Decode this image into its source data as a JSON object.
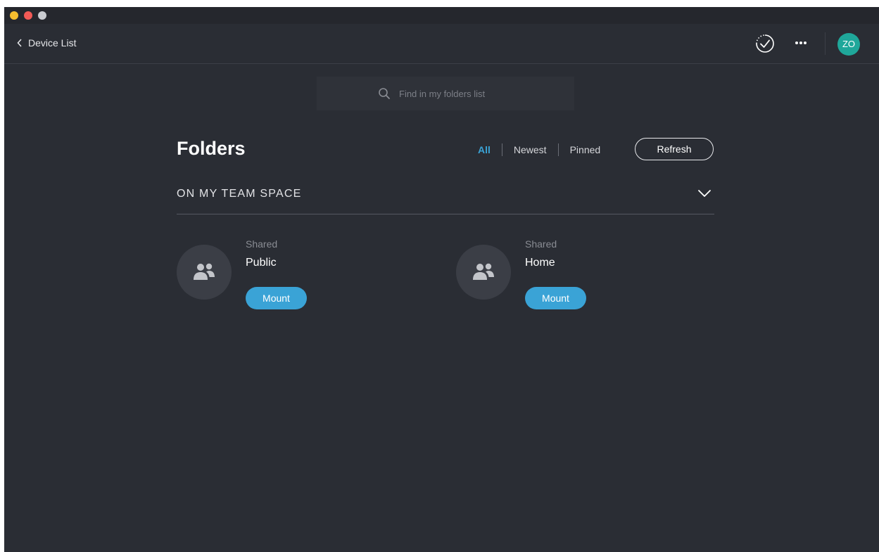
{
  "header": {
    "back_label": "Device List",
    "avatar_initials": "ZO"
  },
  "search": {
    "placeholder": "Find in my folders list",
    "value": ""
  },
  "main": {
    "title": "Folders",
    "filters": [
      {
        "label": "All",
        "active": true
      },
      {
        "label": "Newest",
        "active": false
      },
      {
        "label": "Pinned",
        "active": false
      }
    ],
    "refresh_label": "Refresh",
    "section_label": "ON MY TEAM SPACE",
    "folders": [
      {
        "type": "Shared",
        "name": "Public",
        "action": "Mount"
      },
      {
        "type": "Shared",
        "name": "Home",
        "action": "Mount"
      }
    ]
  },
  "icons": {
    "back": "chevron-left-icon",
    "sync": "sync-check-icon",
    "more": "more-icon",
    "search": "search-icon",
    "collapse": "chevron-down-icon",
    "folder": "users-icon"
  },
  "colors": {
    "background": "#2a2d34",
    "accent": "#3aa3d6",
    "avatar": "#1fa79a"
  }
}
